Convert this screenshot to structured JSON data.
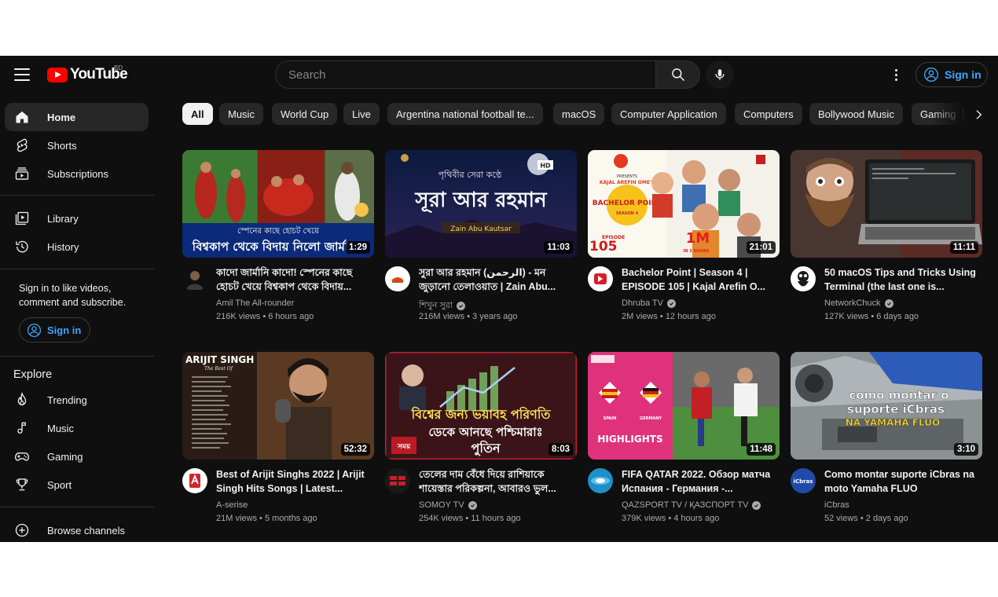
{
  "header": {
    "logo_text": "YouTube",
    "country_code": "BD",
    "search_placeholder": "Search",
    "sign_in_label": "Sign in"
  },
  "sidebar": {
    "items": [
      {
        "label": "Home",
        "icon": "home-icon",
        "active": true
      },
      {
        "label": "Shorts",
        "icon": "shorts-icon"
      },
      {
        "label": "Subscriptions",
        "icon": "subscriptions-icon"
      },
      {
        "label": "Library",
        "icon": "library-icon"
      },
      {
        "label": "History",
        "icon": "history-icon"
      }
    ],
    "signin_prompt": "Sign in to like videos, comment and subscribe.",
    "signin_label": "Sign in",
    "explore_title": "Explore",
    "explore_items": [
      {
        "label": "Trending",
        "icon": "trending-fire-icon"
      },
      {
        "label": "Music",
        "icon": "music-note-icon"
      },
      {
        "label": "Gaming",
        "icon": "gamepad-icon"
      },
      {
        "label": "Sport",
        "icon": "trophy-icon"
      },
      {
        "label": "Browse channels",
        "icon": "add-circle-icon"
      }
    ]
  },
  "chips": [
    "All",
    "Music",
    "World Cup",
    "Live",
    "Argentina national football te...",
    "macOS",
    "Computer Application",
    "Computers",
    "Bollywood Music",
    "Gaming"
  ],
  "videos": [
    {
      "title": "কাদো জার্মানি কাদো! স্পেনের কাছে হোচট খেয়ে বিশ্বকাপ থেকে বিদায়...",
      "channel": "Amil The All-rounder",
      "verified": false,
      "views": "216K views",
      "age": "6 hours ago",
      "duration": "1:29",
      "thumb_text_1": "স্পেনের কাছে হোচট খেয়ে",
      "thumb_text_2": "বিশ্বকাপ থেকে বিদায় নিলো জার্মা"
    },
    {
      "title": "সুরা আর রহমান (الرحمن) - মন জুড়ানো তেলাওয়াত | Zain Abu...",
      "channel": "শিখুন সুরা",
      "verified": true,
      "views": "216M views",
      "age": "3 years ago",
      "duration": "11:03",
      "thumb_text_1": "পৃথিবীর সেরা কণ্ঠে",
      "thumb_text_2": "সূরা আর রহমান",
      "thumb_text_3": "Zain Abu Kautsar",
      "thumb_badge": "HD"
    },
    {
      "title": "Bachelor Point | Season 4 | EPISODE 105 | Kajal Arefin O...",
      "channel": "Dhruba TV",
      "verified": true,
      "views": "2M views",
      "age": "12 hours ago",
      "duration": "21:01",
      "thumb_text_1": "BACHELOR POINT",
      "thumb_text_2": "SEASON 4",
      "thumb_text_3": "EPISODE",
      "thumb_text_4": "105",
      "thumb_text_5": "1M",
      "thumb_text_6": "IN 3 HOURS",
      "thumb_text_7": "KAJAL AREFIN OME'S",
      "thumb_text_8": "PRESENTS"
    },
    {
      "title": "50 macOS Tips and Tricks Using Terminal (the last one is...",
      "channel": "NetworkChuck",
      "verified": true,
      "views": "127K views",
      "age": "6 days ago",
      "duration": "11:11"
    },
    {
      "title": "Best of Arijit Singhs 2022 | Arijit Singh Hits Songs | Latest...",
      "channel": "A-serise",
      "verified": false,
      "views": "21M views",
      "age": "5 months ago",
      "duration": "52:32",
      "thumb_text_1": "ARIJIT SINGH",
      "thumb_text_2": "The Best Of"
    },
    {
      "title": "তেলের দাম বেঁধে দিয়ে রাশিয়াকে শায়েস্তার পরিকল্পনা, আবারও ভুল...",
      "channel": "SOMOY TV",
      "verified": true,
      "views": "254K views",
      "age": "11 hours ago",
      "duration": "8:03",
      "thumb_text_1": "বিশ্বের জন্য ভয়াবহ পরিণতি",
      "thumb_text_2": "ডেকে আনছে পশ্চিমারাঃ",
      "thumb_text_3": "পুতিন",
      "thumb_text_4": "সময়"
    },
    {
      "title": "FIFA QATAR 2022. Обзор матча Испания - Германия -...",
      "channel": "QAZSPORT TV / ҚАЗСПОРТ TV",
      "verified": true,
      "views": "379K views",
      "age": "4 hours ago",
      "duration": "11:48",
      "thumb_text_1": "HIGHLIGHTS",
      "thumb_text_2": "SPAIN",
      "thumb_text_3": "GERMANY"
    },
    {
      "title": "Como montar suporte iCbras na moto Yamaha FLUO",
      "channel": "iCbras",
      "verified": false,
      "views": "52 views",
      "age": "2 days ago",
      "duration": "3:10",
      "thumb_text_1": "como montar o",
      "thumb_text_2": "suporte iCbras",
      "thumb_text_3": "NA YAMAHA FLUO",
      "avatar_text": "iCbras"
    }
  ],
  "colors": {
    "background": "#0f0f0f",
    "accent_blue": "#3ea6ff",
    "logo_red": "#ff0000",
    "chip_bg": "#272727",
    "secondary_text": "#aaaaaa"
  }
}
